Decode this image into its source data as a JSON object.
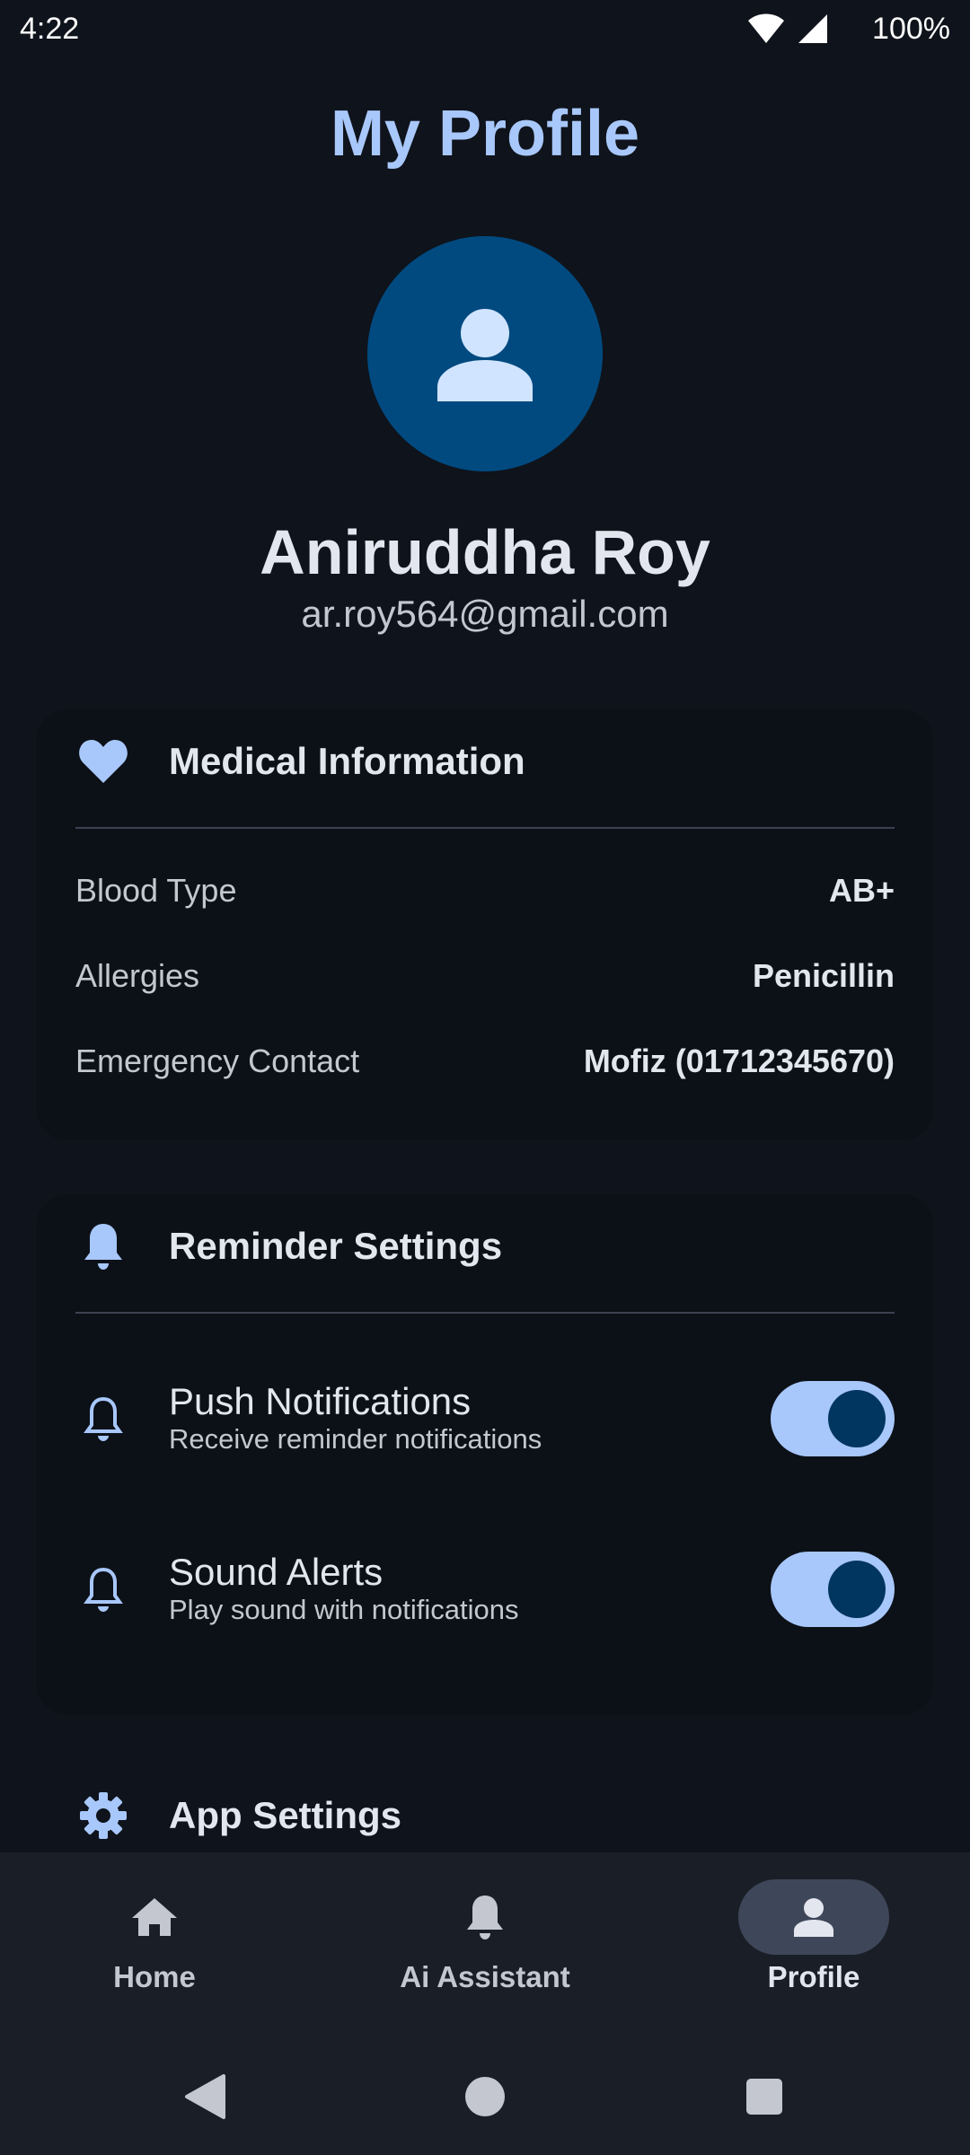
{
  "status_bar": {
    "time": "4:22",
    "battery": "100%"
  },
  "page": {
    "title": "My Profile"
  },
  "profile": {
    "name": "Aniruddha Roy",
    "email": "ar.roy564@gmail.com"
  },
  "medical": {
    "title": "Medical Information",
    "rows": [
      {
        "label": "Blood Type",
        "value": "AB+"
      },
      {
        "label": "Allergies",
        "value": "Penicillin"
      },
      {
        "label": "Emergency Contact",
        "value": "Mofiz (01712345670)"
      }
    ]
  },
  "reminders": {
    "title": "Reminder Settings",
    "items": [
      {
        "title": "Push Notifications",
        "subtitle": "Receive reminder notifications",
        "enabled": true
      },
      {
        "title": "Sound Alerts",
        "subtitle": "Play sound with notifications",
        "enabled": true
      }
    ]
  },
  "app_settings": {
    "title": "App Settings"
  },
  "bottom_nav": {
    "items": [
      {
        "label": "Home",
        "icon": "home-icon"
      },
      {
        "label": "Ai Assistant",
        "icon": "bell-icon"
      },
      {
        "label": "Profile",
        "icon": "person-icon",
        "active": true
      }
    ]
  },
  "colors": {
    "accent": "#a8c7fa",
    "avatar_bg": "#004a80",
    "background": "#0f131b"
  }
}
